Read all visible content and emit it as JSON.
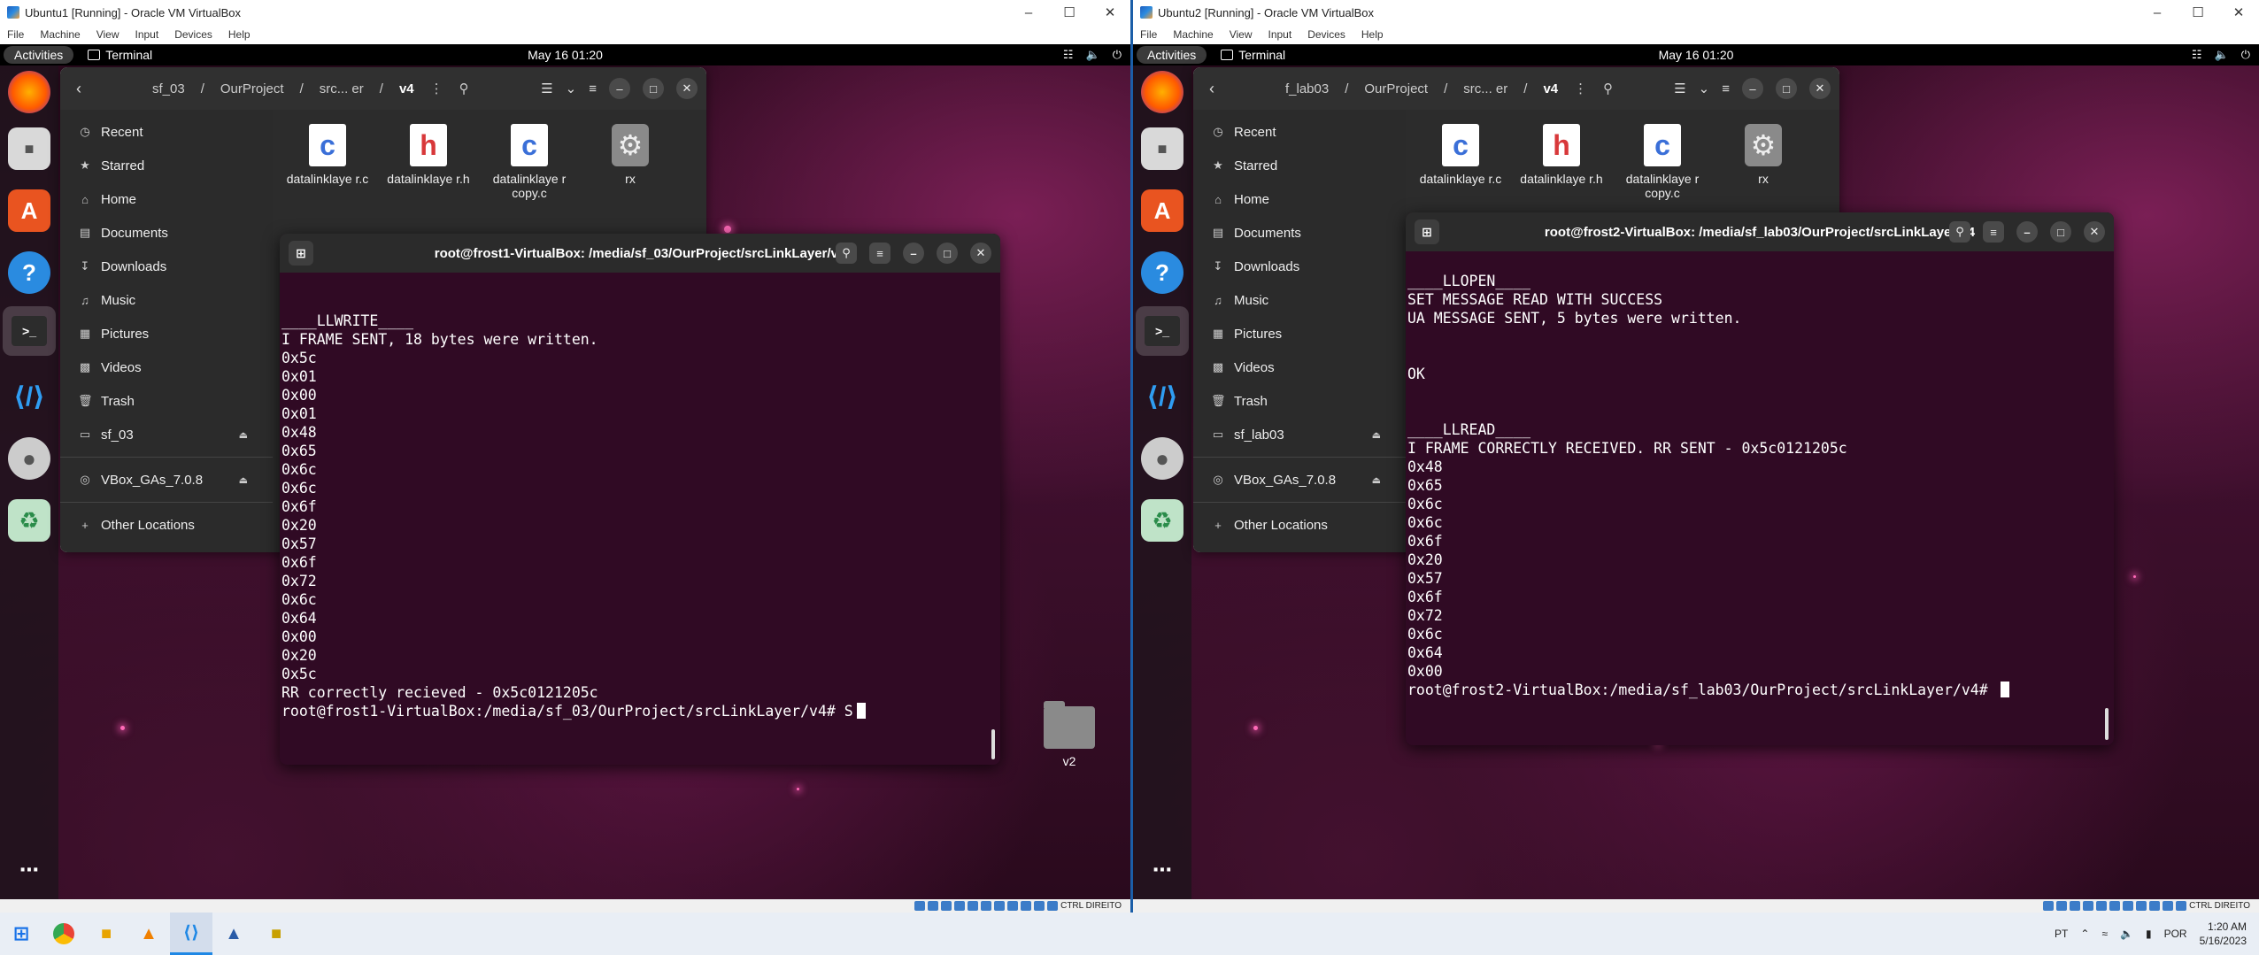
{
  "left_vm": {
    "window_title": "Ubuntu1 [Running] - Oracle VM VirtualBox",
    "menu": [
      "File",
      "Machine",
      "View",
      "Input",
      "Devices",
      "Help"
    ],
    "guest": {
      "activities": "Activities",
      "app_name": "Terminal",
      "clock": "May 16  01:20",
      "files": {
        "path": [
          "sf_03",
          "OurProject",
          "src... er",
          "v4"
        ],
        "sidebar": [
          "Recent",
          "Starred",
          "Home",
          "Documents",
          "Downloads",
          "Music",
          "Pictures",
          "Videos",
          "Trash",
          "sf_03",
          "VBox_GAs_7.0.8",
          "Other Locations"
        ],
        "items": [
          {
            "name": "datalinklaye r.c",
            "letter": "c"
          },
          {
            "name": "datalinklaye r.h",
            "letter": "h"
          },
          {
            "name": "datalinklaye r copy.c",
            "letter": "c"
          },
          {
            "name": "rx",
            "letter": "⚙"
          }
        ]
      },
      "terminal": {
        "title": "root@frost1-VirtualBox: /media/sf_03/OurProject/srcLinkLayer/v4",
        "lines": [
          "",
          "",
          "____LLWRITE____",
          "I FRAME SENT, 18 bytes were written.",
          "0x5c",
          "0x01",
          "0x00",
          "0x01",
          "0x48",
          "0x65",
          "0x6c",
          "0x6c",
          "0x6f",
          "0x20",
          "0x57",
          "0x6f",
          "0x72",
          "0x6c",
          "0x64",
          "0x00",
          "0x20",
          "0x5c",
          "RR correctly recieved - 0x5c0121205c"
        ],
        "prompt": "root@frost1-VirtualBox:/media/sf_03/OurProject/srcLinkLayer/v4# S"
      },
      "desktop_folder": "v2"
    },
    "status_text": "CTRL DIREITO"
  },
  "right_vm": {
    "window_title": "Ubuntu2 [Running] - Oracle VM VirtualBox",
    "menu": [
      "File",
      "Machine",
      "View",
      "Input",
      "Devices",
      "Help"
    ],
    "guest": {
      "activities": "Activities",
      "app_name": "Terminal",
      "clock": "May 16  01:20",
      "files": {
        "path": [
          "f_lab03",
          "OurProject",
          "src... er",
          "v4"
        ],
        "sidebar": [
          "Recent",
          "Starred",
          "Home",
          "Documents",
          "Downloads",
          "Music",
          "Pictures",
          "Videos",
          "Trash",
          "sf_lab03",
          "VBox_GAs_7.0.8",
          "Other Locations"
        ],
        "items": [
          {
            "name": "datalinklaye r.c",
            "letter": "c"
          },
          {
            "name": "datalinklaye r.h",
            "letter": "h"
          },
          {
            "name": "datalinklaye r copy.c",
            "letter": "c"
          },
          {
            "name": "rx",
            "letter": "⚙"
          }
        ]
      },
      "terminal": {
        "title": "root@frost2-VirtualBox: /media/sf_lab03/OurProject/srcLinkLayer/v4",
        "lines": [
          "",
          "____LLOPEN____",
          "SET MESSAGE READ WITH SUCCESS",
          "UA MESSAGE SENT, 5 bytes were written.",
          "",
          "",
          "OK",
          "",
          "",
          "____LLREAD____",
          "I FRAME CORRECTLY RECEIVED. RR SENT - 0x5c0121205c",
          "0x48",
          "0x65",
          "0x6c",
          "0x6c",
          "0x6f",
          "0x20",
          "0x57",
          "0x6f",
          "0x72",
          "0x6c",
          "0x64",
          "0x00"
        ],
        "prompt": "root@frost2-VirtualBox:/media/sf_lab03/OurProject/srcLinkLayer/v4# "
      }
    },
    "status_text": "CTRL DIREITO"
  },
  "host_taskbar": {
    "lang": "PT",
    "kb": "POR",
    "time": "1:20 AM",
    "date": "5/16/2023"
  }
}
